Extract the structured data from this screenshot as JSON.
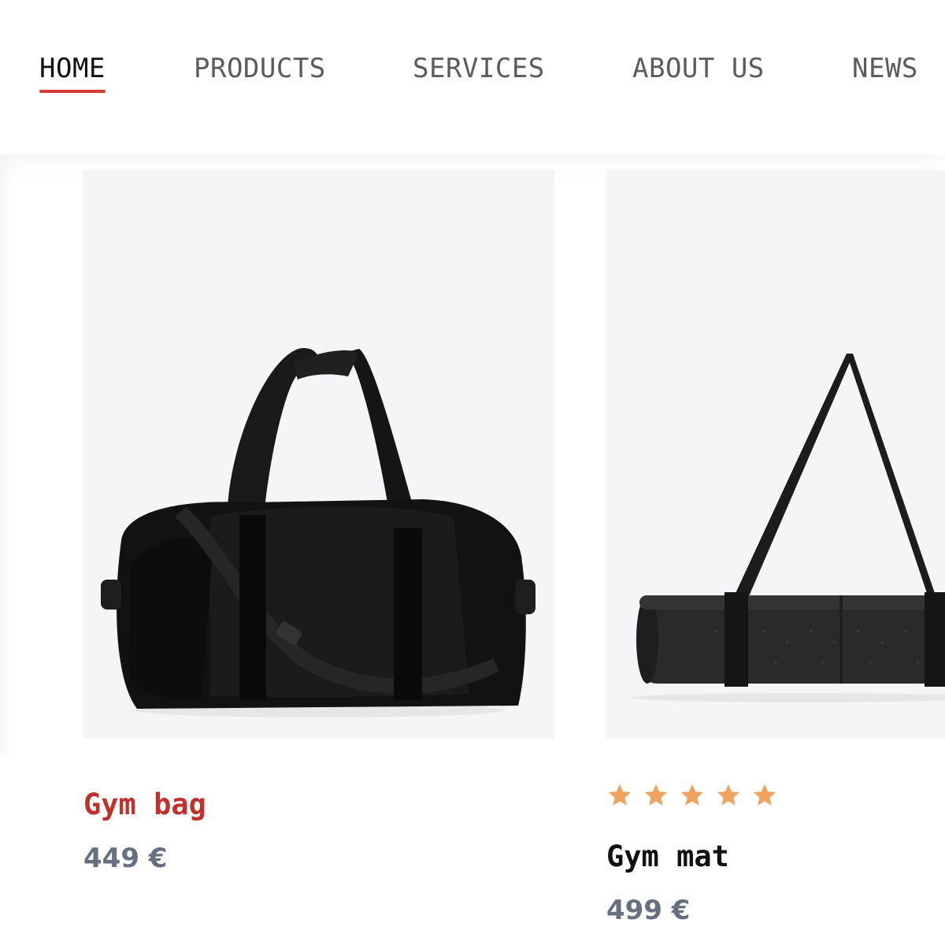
{
  "nav": {
    "items": [
      {
        "label": "HOME",
        "active": true
      },
      {
        "label": "PRODUCTS",
        "active": false
      },
      {
        "label": "SERVICES",
        "active": false
      },
      {
        "label": "ABOUT US",
        "active": false
      },
      {
        "label": "NEWS",
        "active": false
      }
    ],
    "accent_color": "#d93b37"
  },
  "products": [
    {
      "name": "Gym bag",
      "price": "449 €",
      "image_icon": "gym-bag-image",
      "title_color": "#c0312d"
    },
    {
      "name": "Gym mat",
      "price": "499 €",
      "image_icon": "yoga-mat-image",
      "title_color": "#111111",
      "rating": {
        "value": 5,
        "max": 5,
        "star_color": "#f0a35e"
      }
    }
  ]
}
